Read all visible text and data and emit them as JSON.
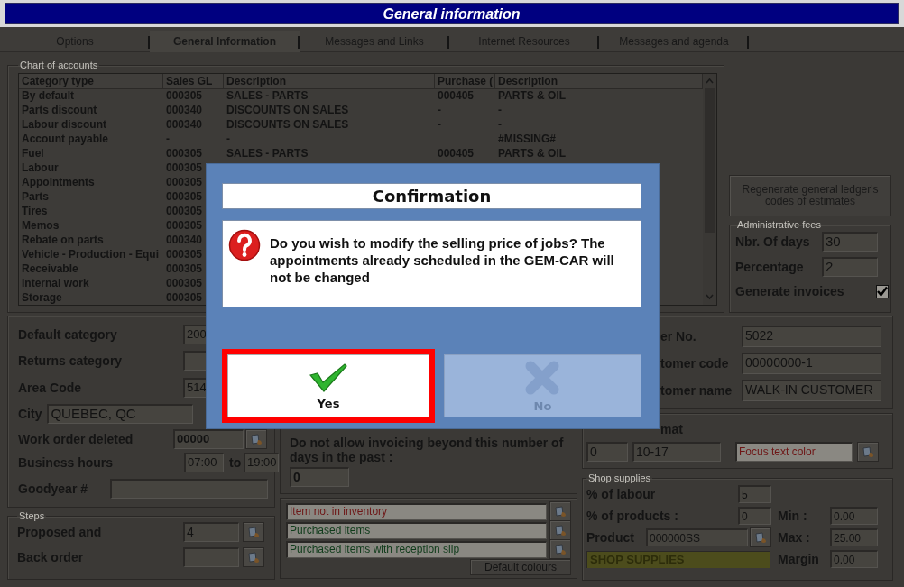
{
  "window": {
    "title": "General information"
  },
  "tabs": [
    {
      "label": "Options",
      "selected": false
    },
    {
      "label": "General Information",
      "selected": true
    },
    {
      "label": "Messages and Links",
      "selected": false
    },
    {
      "label": "Internet Resources",
      "selected": false
    },
    {
      "label": "Messages and agenda",
      "selected": false
    }
  ],
  "chart_of_accounts": {
    "title": "Chart of accounts",
    "columns": [
      "Category type",
      "Sales GL",
      "Description",
      "Purchase (",
      "Description"
    ],
    "rows": [
      {
        "category": "By default",
        "sales_gl": "000305",
        "description": "SALES - PARTS",
        "purchase_gl": "000405",
        "purchase_description": "PARTS & OIL"
      },
      {
        "category": "Parts discount",
        "sales_gl": "000340",
        "description": "DISCOUNTS ON SALES",
        "purchase_gl": "-",
        "purchase_description": "-"
      },
      {
        "category": "Labour discount",
        "sales_gl": "000340",
        "description": "DISCOUNTS ON SALES",
        "purchase_gl": "-",
        "purchase_description": "-"
      },
      {
        "category": "Account payable",
        "sales_gl": "-",
        "description": "-",
        "purchase_description": "#MISSING#"
      },
      {
        "category": "Fuel",
        "sales_gl": "000305",
        "description": "SALES - PARTS",
        "purchase_gl": "000405",
        "purchase_description": "PARTS & OIL"
      },
      {
        "category": "Labour",
        "sales_gl": "000305"
      },
      {
        "category": "Appointments",
        "sales_gl": "000305"
      },
      {
        "category": "Parts",
        "sales_gl": "000305"
      },
      {
        "category": "Tires",
        "sales_gl": "000305"
      },
      {
        "category": "Memos",
        "sales_gl": "000305"
      },
      {
        "category": "Rebate on parts",
        "sales_gl": "000340"
      },
      {
        "category": "Vehicle - Production - Equi",
        "sales_gl": "000305"
      },
      {
        "category": "Receivable",
        "sales_gl": "000305"
      },
      {
        "category": "Internal work",
        "sales_gl": "000305"
      },
      {
        "category": "Storage",
        "sales_gl": "000305"
      }
    ]
  },
  "regenerate_button": "Regenerate general ledger's codes of estimates",
  "administrative_fees": {
    "title": "Administrative fees",
    "fields": [
      {
        "label": "Nbr. Of days",
        "value": "30"
      },
      {
        "label": "Percentage",
        "value": "2"
      }
    ],
    "generate_invoices": {
      "label": "Generate invoices",
      "checked": true
    }
  },
  "general_fields": [
    {
      "label": "Default category",
      "value": "200"
    },
    {
      "label": "Returns category"
    },
    {
      "label": "Area Code",
      "value": "514"
    }
  ],
  "city": {
    "label": "City",
    "value": "QUEBEC, QC"
  },
  "work_order_deleted": {
    "label": "Work order deleted",
    "value": "00000"
  },
  "business_hours": {
    "label": "Business hours",
    "from": "07:00",
    "separator": "to",
    "to": "19:00"
  },
  "goodyear": {
    "label": "Goodyear #"
  },
  "steps": {
    "title": "Steps",
    "rows": [
      {
        "label": "Proposed and",
        "value": "4"
      },
      {
        "label": "Back order"
      }
    ]
  },
  "invoicing_limit": {
    "label": "Do not allow invoicing beyond this number of days in the past :",
    "value": "0"
  },
  "colour_fields": [
    {
      "label": "Item not in inventory",
      "kind": "missing"
    },
    {
      "label": "Purchased items",
      "kind": "purchased"
    },
    {
      "label": "Purchased items with reception slip",
      "kind": "purchased"
    }
  ],
  "default_colours_button": "Default colours",
  "customer_fields": [
    {
      "label": "er No.",
      "value": "5022"
    },
    {
      "label": "tomer code",
      "value": "00000000-1"
    },
    {
      "label": "tomer name",
      "value": "WALK-IN CUSTOMER"
    }
  ],
  "format": {
    "label": "mat",
    "values": [
      "0",
      "10-17"
    ],
    "focus_field": {
      "label": "Focus text color"
    }
  },
  "shop_supplies": {
    "title": "Shop supplies",
    "labour_percent": {
      "label": "% of labour",
      "value": "5"
    },
    "products_percent": {
      "label": "% of products :",
      "value": "0"
    },
    "product": {
      "label": "Product",
      "value": "000000SS"
    },
    "description": "SHOP SUPPLIES",
    "min": {
      "label": "Min :",
      "value": "0.00"
    },
    "max": {
      "label": "Max :",
      "value": "25.00"
    },
    "margin": {
      "label": "Margin",
      "value": "0.00"
    }
  },
  "dialog": {
    "title": "Confirmation",
    "message": "Do you wish to modify the selling price of jobs? The appointments already scheduled in the GEM-CAR will not be changed",
    "buttons": [
      {
        "label": "Yes",
        "kind": "confirm",
        "focused": true,
        "disabled": false
      },
      {
        "label": "No",
        "kind": "cancel",
        "focused": false,
        "disabled": true
      }
    ]
  }
}
